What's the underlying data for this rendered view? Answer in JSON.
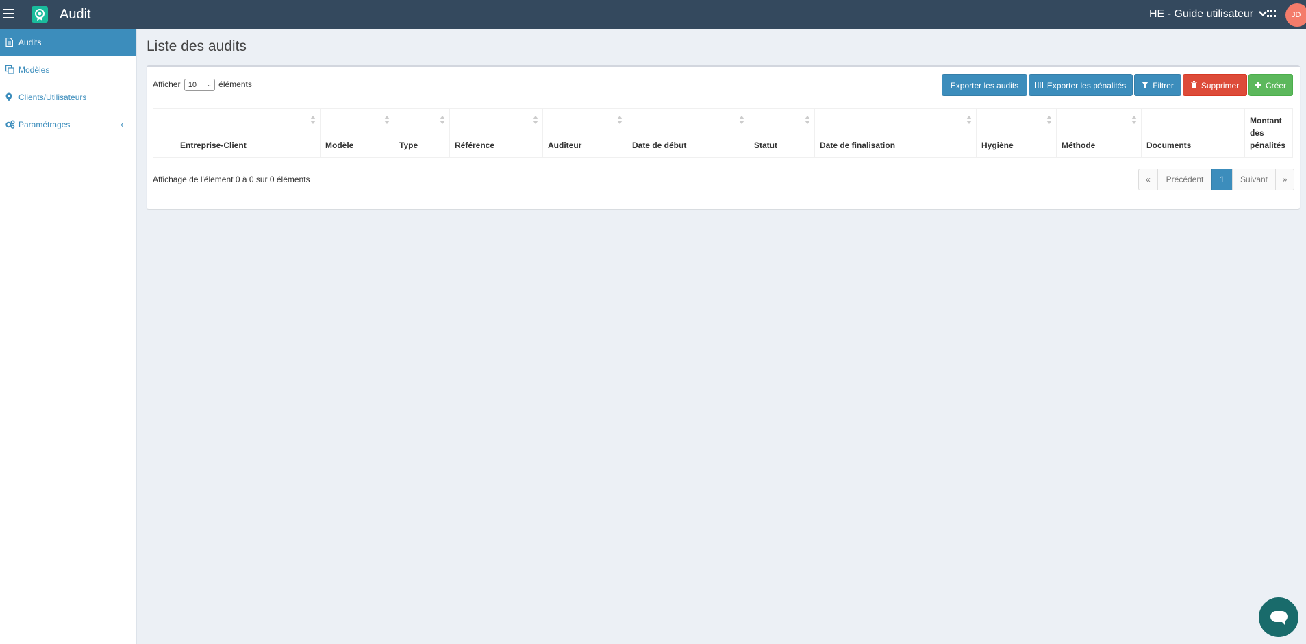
{
  "app": {
    "title": "Audit",
    "organization": "HE - Guide utilisateur",
    "user_initials": "JD"
  },
  "sidebar": {
    "items": [
      {
        "label": "Audits",
        "icon": "file-icon",
        "active": true
      },
      {
        "label": "Modèles",
        "icon": "copy-icon",
        "active": false
      },
      {
        "label": "Clients/Utilisateurs",
        "icon": "map-marker-icon",
        "active": false
      },
      {
        "label": "Paramétrages",
        "icon": "gears-icon",
        "active": false,
        "arrow": "‹"
      }
    ]
  },
  "page": {
    "title": "Liste des audits"
  },
  "toolbar": {
    "show_prefix": "Afficher",
    "show_value": "10",
    "show_suffix": "éléments",
    "export_audits": "Exporter les audits",
    "export_penalties": "Exporter les pénalités",
    "filter": "Filtrer",
    "delete": "Supprimer",
    "create": "Créer"
  },
  "table": {
    "columns": [
      {
        "label": ""
      },
      {
        "label": "Entreprise-Client"
      },
      {
        "label": "Modèle"
      },
      {
        "label": "Type"
      },
      {
        "label": "Référence"
      },
      {
        "label": "Auditeur"
      },
      {
        "label": "Date de début"
      },
      {
        "label": "Statut"
      },
      {
        "label": "Date de finalisation"
      },
      {
        "label": "Hygiène"
      },
      {
        "label": "Méthode"
      },
      {
        "label": "Documents"
      },
      {
        "label": "Montant des pénalités"
      }
    ],
    "rows": []
  },
  "footer": {
    "info": "Affichage de l'élement 0 à 0 sur 0 éléments",
    "pagination": {
      "first": "«",
      "previous": "Précédent",
      "current": "1",
      "next": "Suivant",
      "last": "»"
    }
  },
  "colors": {
    "topbar": "#34495e",
    "accent": "#3c8dbc",
    "danger": "#dd4b39",
    "success": "#5cb85c",
    "chat": "#196b6b"
  }
}
